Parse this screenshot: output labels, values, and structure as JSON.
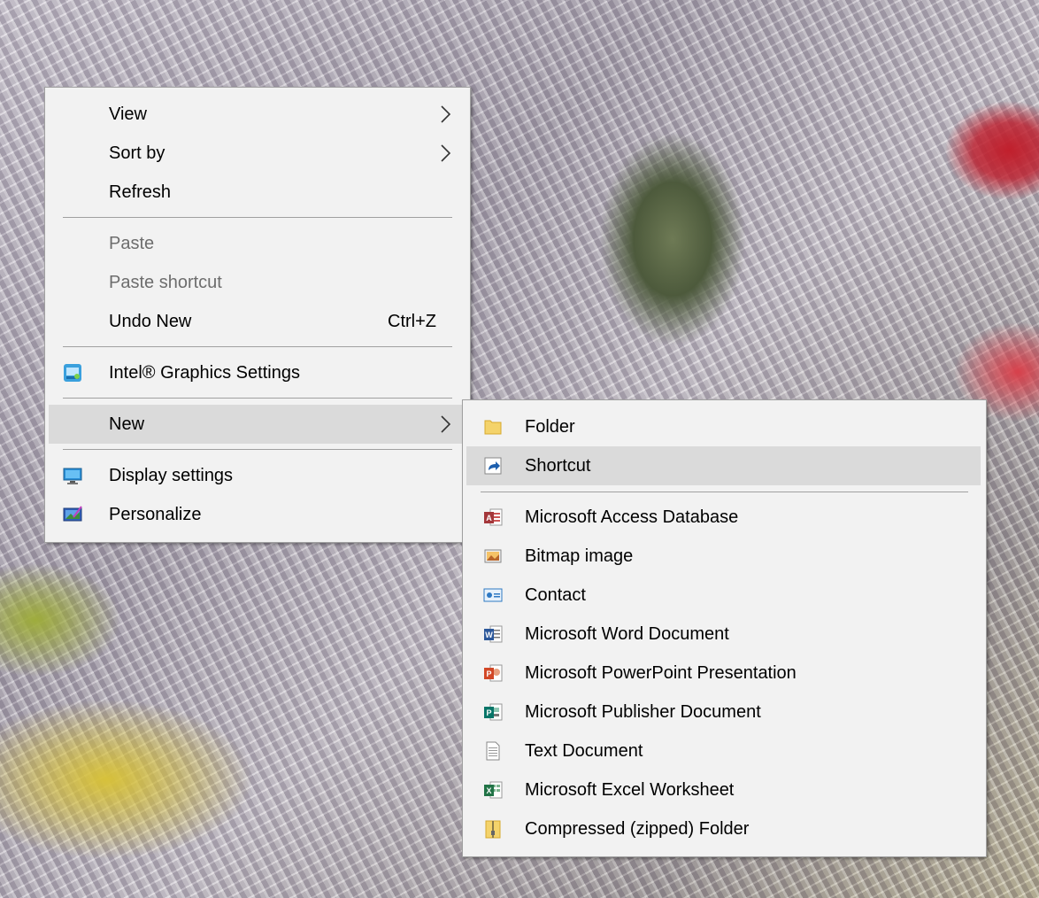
{
  "desktop": {
    "wallpaper": "flower-wallpaper"
  },
  "context_menu": {
    "view": "View",
    "sort_by": "Sort by",
    "refresh": "Refresh",
    "paste": "Paste",
    "paste_shortcut": "Paste shortcut",
    "undo_new": "Undo New",
    "undo_new_shortcut": "Ctrl+Z",
    "intel_graphics": "Intel® Graphics Settings",
    "new": "New",
    "display_settings": "Display settings",
    "personalize": "Personalize"
  },
  "new_submenu": {
    "folder": "Folder",
    "shortcut": "Shortcut",
    "access": "Microsoft Access Database",
    "bitmap": "Bitmap image",
    "contact": "Contact",
    "word": "Microsoft Word Document",
    "powerpoint": "Microsoft PowerPoint Presentation",
    "publisher": "Microsoft Publisher Document",
    "text": "Text Document",
    "excel": "Microsoft Excel Worksheet",
    "zip": "Compressed (zipped) Folder"
  },
  "colors": {
    "menu_bg": "#f2f2f2",
    "hover_bg": "#dadada",
    "disabled_text": "#6d6d6d",
    "separator": "#a0a0a0"
  }
}
